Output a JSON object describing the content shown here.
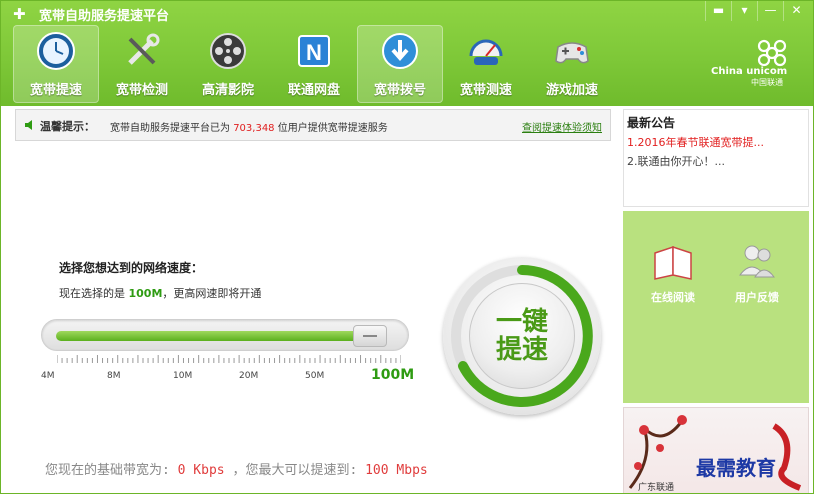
{
  "window": {
    "title": "宽带自助服务提速平台",
    "controls": [
      "▬",
      "▾",
      "—",
      "✕"
    ]
  },
  "nav": {
    "items": [
      {
        "label": "宽带提速",
        "icon": "clock-icon",
        "active": true
      },
      {
        "label": "宽带检测",
        "icon": "tools-icon",
        "active": false
      },
      {
        "label": "高清影院",
        "icon": "film-reel-icon",
        "active": false
      },
      {
        "label": "联通网盘",
        "icon": "netdisk-icon",
        "active": false
      },
      {
        "label": "宽带拨号",
        "icon": "globe-arrow-icon",
        "active": false
      },
      {
        "label": "宽带测速",
        "icon": "speedometer-car-icon",
        "active": false
      },
      {
        "label": "游戏加速",
        "icon": "gamepad-icon",
        "active": false
      }
    ]
  },
  "brand": {
    "en": "China unicom",
    "cn": "中国联通"
  },
  "notice": {
    "label": "温馨提示：",
    "text_before": "宽带自助服务提速平台已为",
    "count": "703,348",
    "text_after": "位用户提供宽带提速服务",
    "link": "查阅提速体验须知"
  },
  "speed": {
    "heading": "选择您想达到的网络速度：",
    "current_prefix": "现在选择的是",
    "current_value": "100M",
    "current_suffix": "，更高网速即将开通",
    "options": [
      "4M",
      "8M",
      "10M",
      "20M",
      "50M",
      "100M"
    ],
    "selected_fraction": 0.95
  },
  "boost_button": {
    "line1": "一键",
    "line2": "提速"
  },
  "bandwidth": {
    "prefix": "您现在的基础带宽为:",
    "base": "0 Kbps",
    "middle": "，您最大可以提速到:",
    "max": "100 Mbps"
  },
  "sidebar": {
    "announcements_title": "最新公告",
    "announcements": [
      {
        "text": "1.2016年春节联通宽带提...",
        "style": "red"
      },
      {
        "text": "2.联通由你开心！...",
        "style": "gray"
      }
    ],
    "services": [
      {
        "label": "在线阅读",
        "icon": "open-book-icon"
      },
      {
        "label": "用户反馈",
        "icon": "users-icon"
      }
    ],
    "ad_caption": "广东联通",
    "watermark": "最需教育"
  },
  "colors": {
    "brand_green": "#7ec838",
    "accent_red": "#e21f1f",
    "speed_green": "#2e9b12"
  }
}
